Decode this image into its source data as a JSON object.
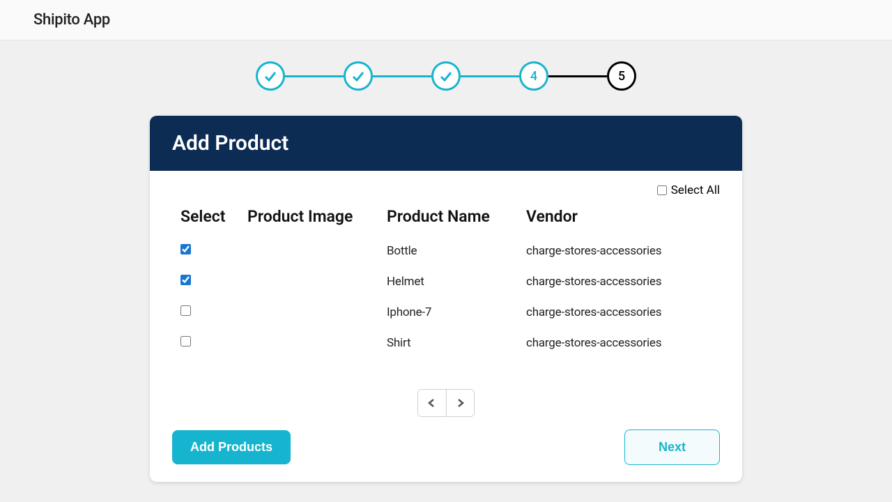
{
  "app": {
    "title": "Shipito App"
  },
  "stepper": {
    "steps": [
      {
        "state": "done"
      },
      {
        "state": "done"
      },
      {
        "state": "done"
      },
      {
        "state": "current",
        "label": "4"
      },
      {
        "state": "future",
        "label": "5"
      }
    ]
  },
  "card": {
    "title": "Add Product",
    "select_all_label": "Select All",
    "select_all_checked": false,
    "columns": {
      "select": "Select",
      "image": "Product Image",
      "name": "Product Name",
      "vendor": "Vendor"
    },
    "rows": [
      {
        "selected": true,
        "image": "",
        "name": "Bottle",
        "vendor": "charge-stores-accessories"
      },
      {
        "selected": true,
        "image": "",
        "name": "Helmet",
        "vendor": "charge-stores-accessories"
      },
      {
        "selected": false,
        "image": "",
        "name": "Iphone-7",
        "vendor": "charge-stores-accessories"
      },
      {
        "selected": false,
        "image": "",
        "name": "Shirt",
        "vendor": "charge-stores-accessories"
      }
    ],
    "buttons": {
      "add": "Add Products",
      "next": "Next"
    }
  }
}
